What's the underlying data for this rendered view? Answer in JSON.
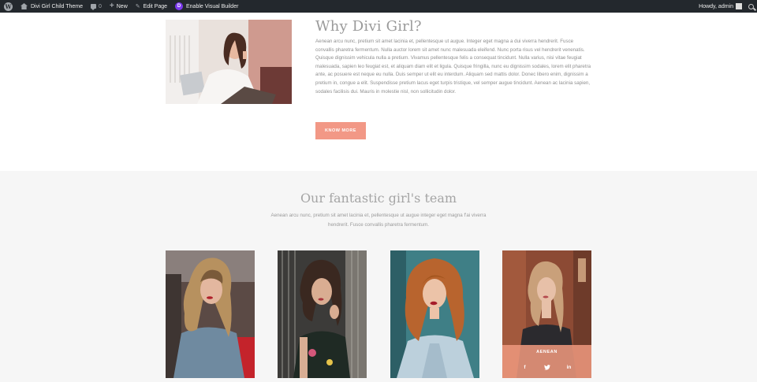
{
  "adminbar": {
    "site_name": "Divi Girl Child Theme",
    "comments_count": "0",
    "new_label": "New",
    "edit_label": "Edit Page",
    "divi_letter": "D",
    "visual_builder_label": "Enable Visual Builder",
    "howdy_label": "Howdy, admin"
  },
  "intro": {
    "title": "Why Divi Girl?",
    "body": "Aenean arcu nunc, pretium sit amet lacinia et, pellentesque ut augue. Integer eget magna a dui viverra hendrerit. Fusce convallis pharetra fermentum. Nulla auctor lorem sit amet nunc malesuada eleifend. Nunc porta risus vel hendrerit venenatis. Quisque dignissim vehicula nulla a pretium. Vivamus pellentesque felis a consequat tincidunt. Nulla varius, nisi vitae feugiat malesuada, sapien leo feugiat est, et aliquam diam elit et ligula. Quisque fringilla, nunc eu dignissim sodales, lorem elit pharetra ante, ac posuere est neque eu nulla. Duis semper ut elit eu interdum. Aliquam sed mattis dolor. Donec libero enim, dignissim a pretium in, congue a elit. Suspendisse pretium lacus eget turpis tristique, vel semper augue tincidunt. Aenean ac lacinia sapien, sodales facilisis dui. Mauris in molestie nisl, non sollicitudin dolor.",
    "button_label": "KNOW MORE"
  },
  "team": {
    "title": "Our fantastic girl's team",
    "description": "Aenean arcu nunc, pretium sit amet lacinia et, pellentesque ut augue integer eget magna f'ai viverra hendrerit. Fusce convallis pharetra fermentum.",
    "hover_name": "AENEAN",
    "social": {
      "facebook": "f",
      "twitter": "t",
      "linkedin": "in"
    }
  },
  "colors": {
    "adminbar": "#23282d",
    "accent": "#f29886",
    "team_bg": "#f6f6f6",
    "overlay": "#ec967c"
  }
}
